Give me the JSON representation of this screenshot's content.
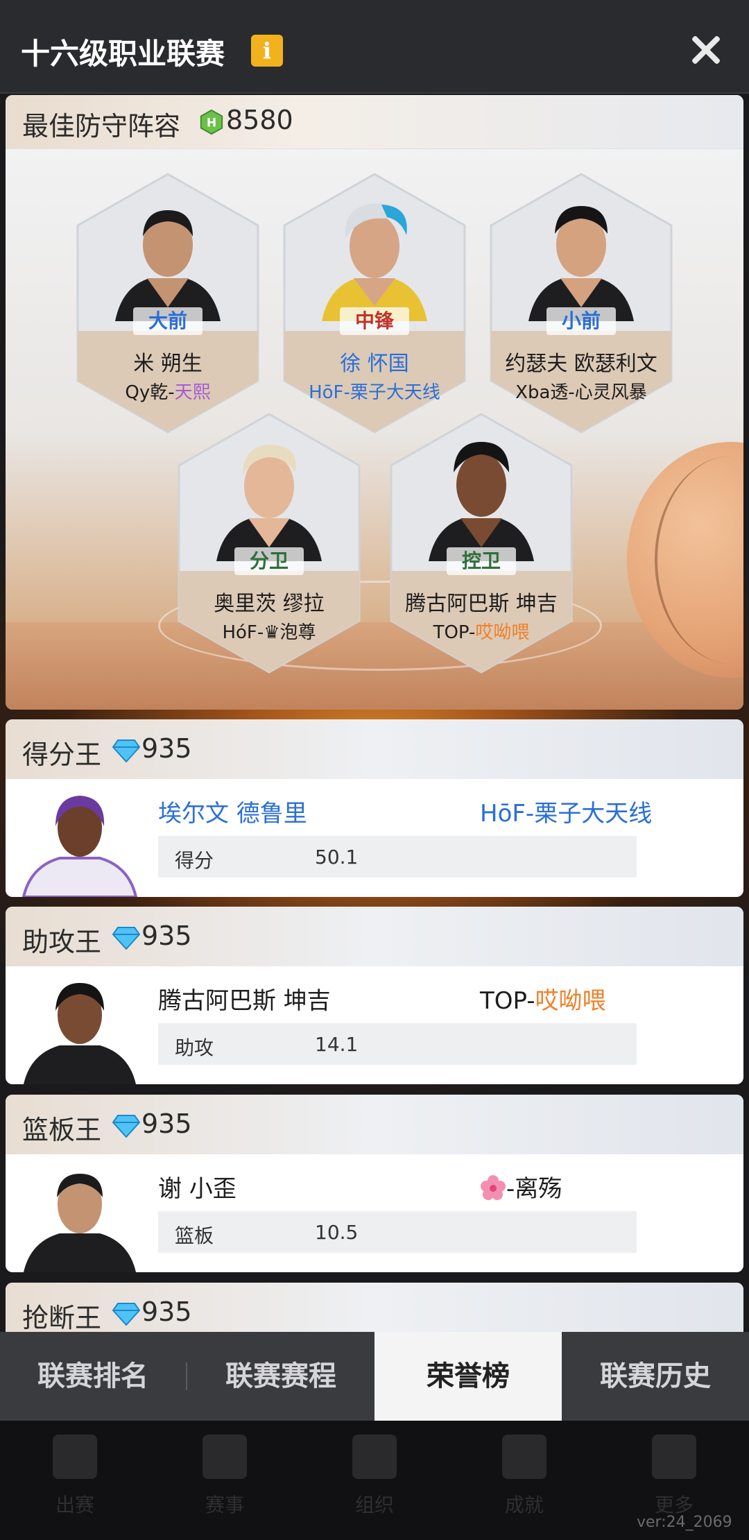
{
  "header": {
    "title": "十六级职业联赛",
    "info_icon": "i"
  },
  "defense": {
    "label": "最佳防守阵容",
    "score": "8580",
    "players": [
      {
        "position": "大前",
        "name": "米 朔生",
        "team_prefix": "Qy乾-",
        "team_suffix": "天熙"
      },
      {
        "position": "中锋",
        "name": "徐 怀国",
        "team_prefix": "HōF-栗子大天线",
        "team_suffix": ""
      },
      {
        "position": "小前",
        "name": "约瑟夫 欧瑟利文",
        "team_prefix": "Xba透-心灵风暴",
        "team_suffix": ""
      },
      {
        "position": "分卫",
        "name": "奥里茨 缪拉",
        "team_prefix": "HóF-♛泡尊",
        "team_suffix": ""
      },
      {
        "position": "控卫",
        "name": "腾古阿巴斯 坤吉",
        "team_prefix": "TOP-",
        "team_suffix": "哎呦喂"
      }
    ]
  },
  "awards": [
    {
      "label": "得分王",
      "score": "935",
      "player": "埃尔文 德鲁里",
      "team_prefix": "HōF-栗子大天线",
      "team_suffix": "",
      "stat_label": "得分",
      "stat_value": "50.1"
    },
    {
      "label": "助攻王",
      "score": "935",
      "player": "腾古阿巴斯 坤吉",
      "team_prefix": "TOP-",
      "team_suffix": "哎呦喂",
      "stat_label": "助攻",
      "stat_value": "14.1"
    },
    {
      "label": "篮板王",
      "score": "935",
      "player": "谢 小歪",
      "team_prefix": "-离殇",
      "team_suffix": "",
      "stat_label": "篮板",
      "stat_value": "10.5"
    },
    {
      "label": "抢断王",
      "score": "935"
    }
  ],
  "tabs": [
    "联赛排名",
    "联赛赛程",
    "荣誉榜",
    "联赛历史"
  ],
  "bottom_nav": [
    "出赛",
    "赛事",
    "组织",
    "成就",
    "更多"
  ],
  "version": "ver:24_2069",
  "colors": {
    "accent_blue": "#2a6ed8",
    "accent_orange": "#f0802a",
    "accent_purple": "#a35ad6",
    "info_yellow": "#f1b21e"
  }
}
